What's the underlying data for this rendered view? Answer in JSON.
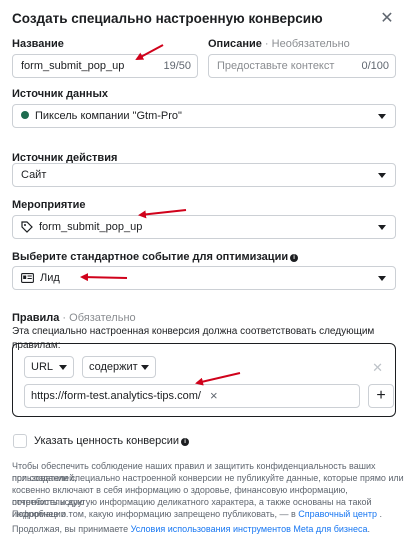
{
  "dialog": {
    "title": "Создать специально настроенную конверсию",
    "close_icon": "close-icon"
  },
  "name_field": {
    "label": "Название",
    "value": "form_submit_pop_up",
    "counter": "19/50"
  },
  "description_field": {
    "label": "Описание",
    "optional": " · Необязательно",
    "placeholder": "Предоставьте контекст",
    "counter": "0/100"
  },
  "data_source": {
    "label": "Источник данных",
    "value": "Пиксель компании \"Gtm-Pro\"",
    "dot_color": "#1d6b4e"
  },
  "action_source": {
    "label": "Источник действия",
    "value": "Сайт"
  },
  "event": {
    "label": "Мероприятие",
    "value": "form_submit_pop_up",
    "icon": "event-tag-icon"
  },
  "standard_event": {
    "label": "Выберите стандартное событие для оптимизации",
    "value": "Лид",
    "icon": "id-card-icon"
  },
  "rules": {
    "label": "Правила",
    "required": " · Обязательно",
    "description": "Эта специально настроенная конверсия должна соответствовать следующим правилам:",
    "field_select": "URL",
    "operator_select": "содержит",
    "url_token": "https://form-test.analytics-tips.com/",
    "add_label": "+"
  },
  "value_checkbox": {
    "label": "Указать ценность конверсии"
  },
  "disclaimer": {
    "line1": "Чтобы обеспечить соблюдение наших правил и защитить конфиденциальность ваших пользователей,",
    "line2": "при создании специально настроенной конверсии не публикуйте данные, которые прямо или",
    "line3": "косвенно включают в себя информацию о здоровье, финансовую информацию, потребительскую",
    "line4": "отчетность и другую информацию деликатного характера, а также основаны на такой информации.",
    "line5_pre": "Подробнее о том, какую информацию запрещено публиковать, — в ",
    "line5_link": "Справочный центр",
    "line5_post": " ."
  },
  "terms": {
    "pre": "Продолжая, вы принимаете ",
    "link": "Условия использования инструментов Meta для бизнеса",
    "post": "."
  },
  "colors": {
    "arrow": "#d0021b",
    "link": "#1877f2",
    "border": "#ccd0d5"
  }
}
